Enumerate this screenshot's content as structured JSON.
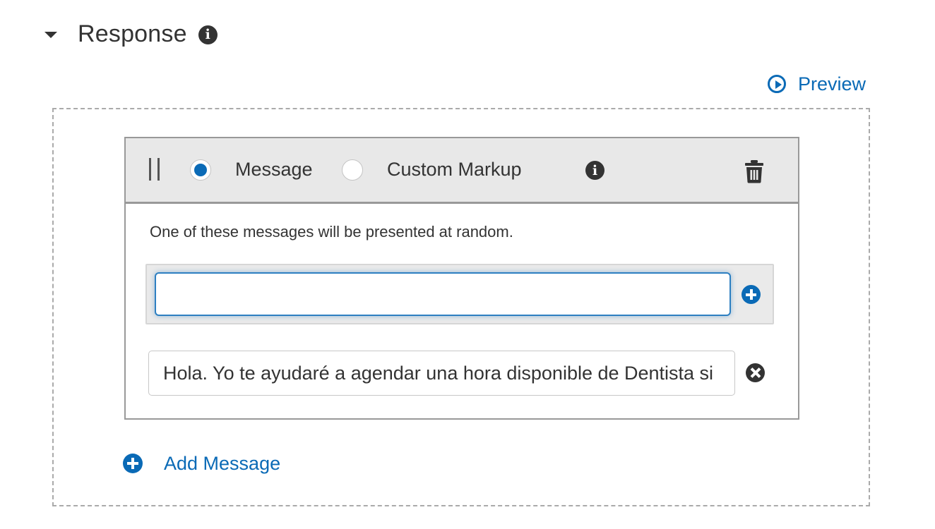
{
  "section": {
    "title": "Response",
    "info_icon": "info-icon",
    "expand_icon": "caret-down-icon"
  },
  "preview": {
    "label": "Preview",
    "icon": "play-circle-icon"
  },
  "card": {
    "drag_icon": "drag-handle-icon",
    "type_options": [
      {
        "label": "Message",
        "selected": true
      },
      {
        "label": "Custom Markup",
        "selected": false
      }
    ],
    "info_icon": "info-icon",
    "delete_icon": "trash-icon",
    "hint": "One of these messages will be presented at random.",
    "new_message": {
      "value": "",
      "placeholder": "",
      "add_icon": "plus-circle-icon"
    },
    "messages": [
      {
        "value": "Hola. Yo te ayudaré a agendar una hora disponible de Dentista si",
        "remove_icon": "remove-circle-icon"
      }
    ]
  },
  "add_message": {
    "label": "Add Message",
    "icon": "plus-circle-icon"
  },
  "colors": {
    "accent": "#0a6ab6",
    "header_bg": "#e8e8e8",
    "text": "#333333"
  }
}
